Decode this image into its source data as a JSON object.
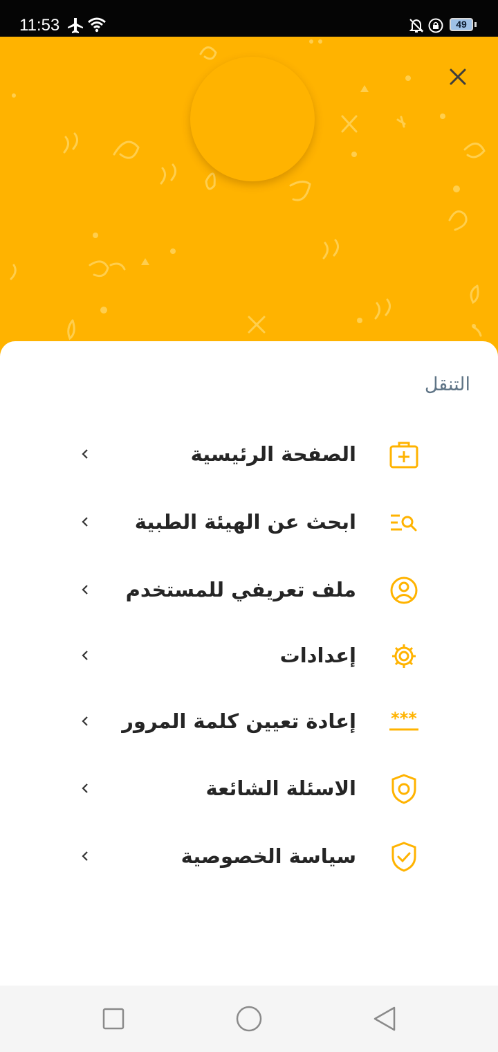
{
  "status_bar": {
    "time": "11:53",
    "battery_level": "49",
    "icons": [
      "airplane-icon",
      "wifi-icon",
      "notifications-off-icon",
      "rotation-lock-icon",
      "battery-icon"
    ]
  },
  "header": {
    "background_color": "#ffb300",
    "close_icon": "close-icon"
  },
  "nav_section": {
    "title": "التنقل",
    "items": [
      {
        "label": "الصفحة الرئيسية",
        "icon": "medical-kit-icon"
      },
      {
        "label": "ابحث عن الهيئة الطبية",
        "icon": "search-list-icon"
      },
      {
        "label": "ملف تعريفي للمستخدم",
        "icon": "user-profile-icon"
      },
      {
        "label": "إعدادات",
        "icon": "gear-icon"
      },
      {
        "label": "إعادة تعيين كلمة المرور",
        "icon": "password-icon"
      },
      {
        "label": "الاسئلة الشائعة",
        "icon": "shield-user-icon"
      },
      {
        "label": "سياسة الخصوصية",
        "icon": "shield-check-icon"
      }
    ]
  },
  "colors": {
    "accent": "#ffb300",
    "icon": "#ffb300",
    "label_text": "#252525",
    "section_title": "#5f7486"
  },
  "system_nav": {
    "buttons": [
      "recent-apps-icon",
      "home-icon",
      "back-icon"
    ]
  }
}
